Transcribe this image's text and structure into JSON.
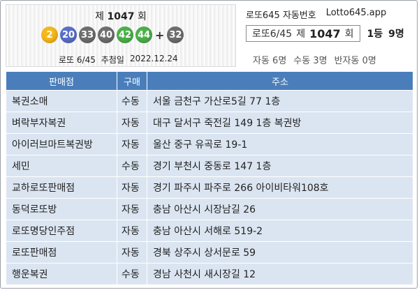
{
  "draw": {
    "prefix": "제",
    "round": "1047",
    "suffix": "회",
    "balls": [
      {
        "value": "2",
        "color": "#f5b81c"
      },
      {
        "value": "20",
        "color": "#5970c8"
      },
      {
        "value": "33",
        "color": "#6e6e6e"
      },
      {
        "value": "40",
        "color": "#6e6e6e"
      },
      {
        "value": "42",
        "color": "#4cb04a"
      },
      {
        "value": "44",
        "color": "#4cb04a"
      }
    ],
    "plus": "+",
    "bonus": {
      "value": "32",
      "color": "#6e6e6e"
    },
    "game": "로또 6/45",
    "date_label": "추첨일",
    "date": "2022.12.24"
  },
  "app": {
    "name": "로또645 자동번호",
    "domain": "Lotto645.app"
  },
  "summary": {
    "game": "로또6/45",
    "prefix": "제",
    "round": "1047",
    "suffix": "회",
    "rank": "1등",
    "winners": "9명",
    "auto": "자동 6명",
    "manual": "수동 3명",
    "semi": "반자동 0명"
  },
  "table": {
    "headers": [
      "판매점",
      "구매",
      "주소"
    ],
    "rows": [
      {
        "shop": "복권소매",
        "kind": "수동",
        "address": "서울 금천구 가산로5길 77 1층"
      },
      {
        "shop": "벼락부자복권",
        "kind": "자동",
        "address": "대구 달서구 죽전길 149 1층 복권방"
      },
      {
        "shop": "아이러브마트복권방",
        "kind": "자동",
        "address": "울산 중구 유곡로 19-1"
      },
      {
        "shop": "세민",
        "kind": "수동",
        "address": "경기 부천시 중동로 147 1층"
      },
      {
        "shop": "교하로또판매점",
        "kind": "자동",
        "address": "경기 파주시 파주로 266 아이비타워108호"
      },
      {
        "shop": "동덕로또방",
        "kind": "자동",
        "address": "충남 아산시 시장남길 26"
      },
      {
        "shop": "로또명당인주점",
        "kind": "자동",
        "address": "충남 아산시 서해로 519-2"
      },
      {
        "shop": "로또판매점",
        "kind": "자동",
        "address": "경북 상주시 상서문로 59"
      },
      {
        "shop": "행운복권",
        "kind": "수동",
        "address": "경남 사천시 새시장길 12"
      }
    ]
  },
  "colors": {
    "header_bg": "#4a7ebb",
    "row_bg": "#dbe5f1"
  }
}
